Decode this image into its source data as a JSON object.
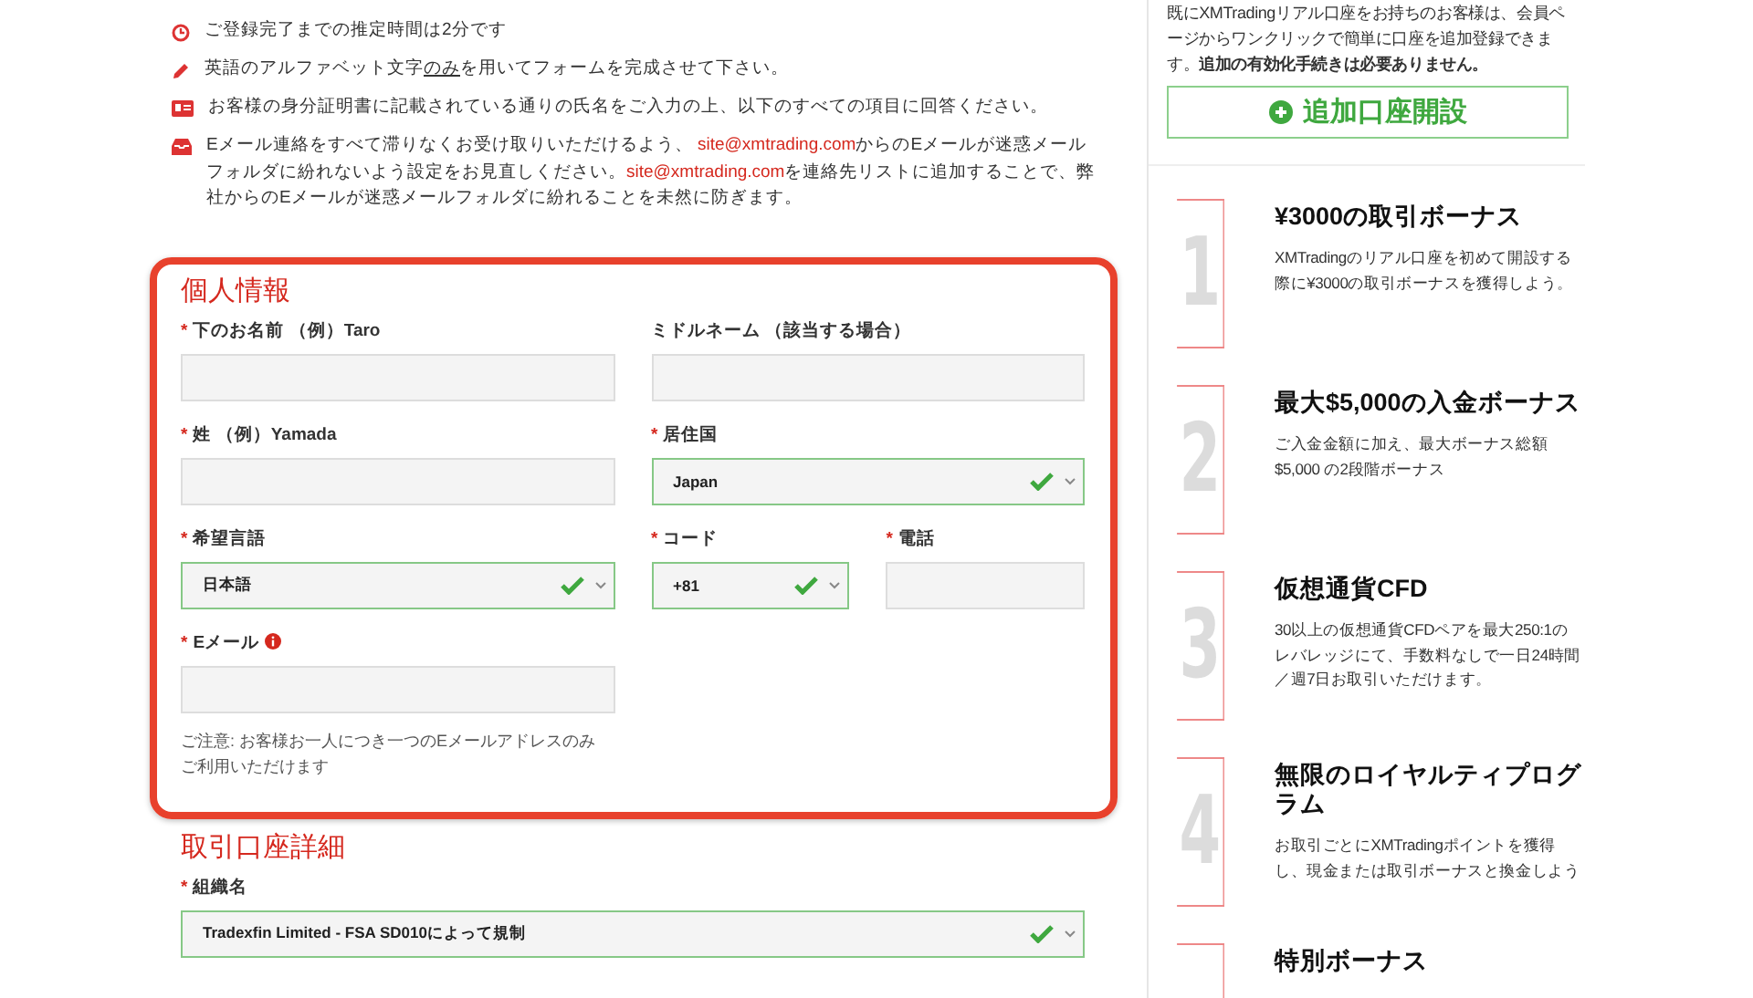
{
  "notes": [
    {
      "kind": "clock",
      "segments": [
        {
          "kind": "plain",
          "text": "ご登録完了までの推定時間は2分です"
        }
      ]
    },
    {
      "kind": "pencil",
      "segments": [
        {
          "kind": "plain",
          "text": "英語のアルファベット文字"
        },
        {
          "kind": "underline",
          "text": "のみ"
        },
        {
          "kind": "plain",
          "text": "を用いてフォームを完成させて下さい。"
        }
      ]
    },
    {
      "kind": "id-card",
      "segments": [
        {
          "kind": "plain",
          "text": "お客様の身分証明書に記載されている通りの氏名をご入力の上、以下のすべての項目に回答ください。"
        }
      ]
    },
    {
      "kind": "inbox",
      "segments": [
        {
          "kind": "plain",
          "text": "Eメール連絡をすべて滞りなくお受け取りいただけるよう、 "
        },
        {
          "kind": "link",
          "text": "site@xmtrading.com"
        },
        {
          "kind": "plain",
          "text": "からのEメールが迷惑メールフォルダに紛れないよう設定をお見直しください。"
        },
        {
          "kind": "link",
          "text": "site@xmtrading.com"
        },
        {
          "kind": "plain",
          "text": "を連絡先リストに追加することで、弊社からのEメールが迷惑メールフォルダに紛れることを未然に防ぎます。"
        }
      ]
    }
  ],
  "personal": {
    "title": "個人情報",
    "highlighted": true,
    "rows": [
      [
        [
          {
            "label": "下のお名前 （例）Taro",
            "required_mark": "*",
            "kind": "text",
            "valid": false
          }
        ],
        [
          {
            "label": "ミドルネーム （該当する場合）",
            "kind": "text",
            "valid": false
          }
        ]
      ],
      [
        [
          {
            "label": "姓 （例）Yamada",
            "required_mark": "*",
            "kind": "text",
            "valid": false
          }
        ],
        [
          {
            "label": "居住国",
            "required_mark": "*",
            "kind": "select",
            "value": "Japan",
            "valid": true
          }
        ]
      ],
      [
        [
          {
            "label": "希望言語",
            "required_mark": "*",
            "kind": "select",
            "value": "日本語",
            "valid": true
          }
        ],
        [
          {
            "label": "コード",
            "required_mark": "*",
            "kind": "select",
            "value": "+81",
            "valid": true
          },
          {
            "label": "電話",
            "required_mark": "*",
            "kind": "text",
            "valid": false
          }
        ]
      ],
      [
        [
          {
            "label": "Eメール",
            "required_mark": "*",
            "kind": "text",
            "valid": false,
            "info": true,
            "note": "ご注意: お客様お一人につき一つのEメールアドレスのみご利用いただけます"
          }
        ],
        []
      ]
    ]
  },
  "account": {
    "title": "取引口座詳細",
    "highlighted": false,
    "rows": [
      [
        [
          {
            "label": "組織名",
            "required_mark": "*",
            "kind": "select",
            "value": "Tradexfin Limited - FSA SD010によって規制",
            "valid": true
          }
        ]
      ]
    ]
  },
  "sidebar": {
    "intro": "既にXMTradingリアル口座をお持ちのお客様は、会員ページからワンクリックで簡単に口座を追加登録できます。**追加の有効化手続きは必要ありません。**",
    "button": "追加口座開設",
    "bonuses": [
      {
        "number": "1",
        "title": "¥3000の取引ボーナス",
        "text": "XMTradingのリアル口座を初めて開設する際に¥3000の取引ボーナスを獲得しよう。"
      },
      {
        "number": "2",
        "title": "最大$5,000の入金ボーナス",
        "text": "ご入金金額に加え、最大ボーナス総額$5,000 の2段階ボーナス"
      },
      {
        "number": "3",
        "title": "仮想通貨CFD",
        "text": "30以上の仮想通貨CFDペアを最大250:1のレバレッジにて、手数料なしで一日24時間／週7日お取引いただけます。"
      },
      {
        "number": "4",
        "title": "無限のロイヤルティプログラム",
        "text": "お取引ごとにXMTradingポイントを獲得し、現金または取引ボーナスと換金しよう"
      },
      {
        "title": "特別ボーナス"
      }
    ]
  }
}
